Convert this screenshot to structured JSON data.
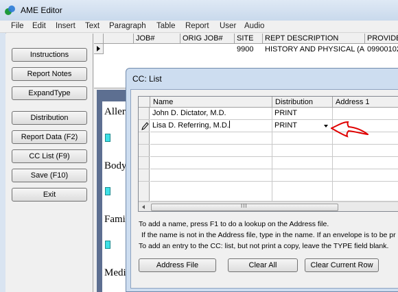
{
  "app": {
    "title": "AME Editor"
  },
  "menu": [
    "File",
    "Edit",
    "Insert",
    "Text",
    "Paragraph",
    "Table",
    "Report",
    "User",
    "Audio"
  ],
  "left_buttons": [
    "Instructions",
    "Report Notes",
    "ExpandType",
    "Distribution",
    "Report Data (F2)",
    "CC List (F9)",
    "Save (F10)",
    "Exit"
  ],
  "job_grid": {
    "columns": [
      "JOB#",
      "ORIG JOB#",
      "SITE",
      "REPT DESCRIPTION",
      "PROVIDE"
    ],
    "row": {
      "job": "",
      "orig_job": "",
      "site": "9900",
      "rept_description": "HISTORY AND PHYSICAL (AN",
      "provider": "09900102"
    }
  },
  "sections": [
    "Aller",
    "Body",
    "Fami",
    "Medi"
  ],
  "dialog": {
    "title": "CC: List",
    "columns": [
      "Name",
      "Distribution",
      "Address 1"
    ],
    "rows": [
      {
        "name": "John D. Dictator, M.D.",
        "distribution": "PRINT",
        "address1": ""
      },
      {
        "name": "Lisa D. Referring, M.D.",
        "distribution": "PRINT",
        "address1": ""
      }
    ],
    "scroll_grip": "III",
    "instructions": [
      "To add a name, press F1 to do a lookup on the Address file.",
      "If the name is not in the Address file, type in the name.  If an envelope is to be pr",
      "To add an entry to the CC: list, but not print a copy, leave the TYPE field blank."
    ],
    "buttons": [
      "Address File",
      "Clear All",
      "Clear Current Row"
    ]
  },
  "colors": {
    "annotation_arrow": "#e00000",
    "doc_background": "#5d6f91",
    "section_marker": "#3ee0e6"
  }
}
